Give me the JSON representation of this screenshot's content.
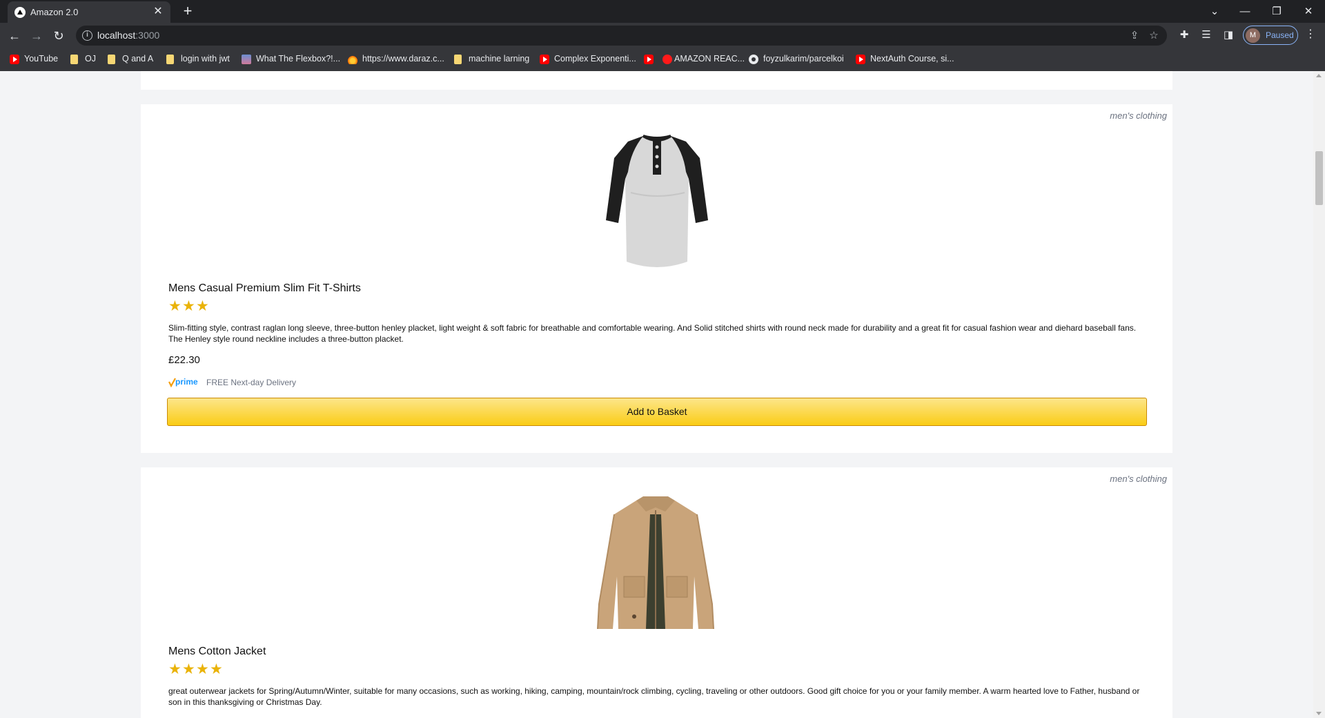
{
  "browser": {
    "tab_title": "Amazon 2.0",
    "url_host": "localhost",
    "url_port": ":3000",
    "profile_initial": "M",
    "profile_status": "Paused",
    "bookmarks": [
      {
        "label": "YouTube",
        "icon": "youtube-icon"
      },
      {
        "label": "OJ",
        "icon": "folder-icon"
      },
      {
        "label": "Q and A",
        "icon": "folder-icon"
      },
      {
        "label": "login with jwt",
        "icon": "folder-icon"
      },
      {
        "label": "What The Flexbox?!...",
        "icon": "image-icon"
      },
      {
        "label": "https://www.daraz.c...",
        "icon": "daraz-icon"
      },
      {
        "label": "machine larning",
        "icon": "folder-icon"
      },
      {
        "label": "Complex Exponenti...",
        "icon": "youtube-icon"
      },
      {
        "label": "AMAZON REAC...",
        "icon": "youtube-icon"
      },
      {
        "label": "foyzulkarim/parcelkoi",
        "icon": "github-icon"
      },
      {
        "label": "NextAuth Course, si...",
        "icon": "youtube-icon"
      }
    ]
  },
  "products": [
    {
      "category": "men's clothing",
      "title": "Mens Casual Premium Slim Fit T-Shirts",
      "rating": 3,
      "description": "Slim-fitting style, contrast raglan long sleeve, three-button henley placket, light weight & soft fabric for breathable and comfortable wearing. And Solid stitched shirts with round neck made for durability and a great fit for casual fashion wear and diehard baseball fans. The Henley style round neckline includes a three-button placket.",
      "price": "£22.30",
      "prime_text": "FREE Next-day Delivery",
      "button_label": "Add to Basket"
    },
    {
      "category": "men's clothing",
      "title": "Mens Cotton Jacket",
      "rating": 4,
      "description": "great outerwear jackets for Spring/Autumn/Winter, suitable for many occasions, such as working, hiking, camping, mountain/rock climbing, cycling, traveling or other outdoors. Good gift choice for you or your family member. A warm hearted love to Father, husband or son in this thanksgiving or Christmas Day."
    }
  ],
  "colors": {
    "star": "#eab308",
    "button_top": "#fde68a",
    "button_bottom": "#facc15",
    "prime_blue": "#1a98ff",
    "prime_check": "#f59e0b"
  }
}
